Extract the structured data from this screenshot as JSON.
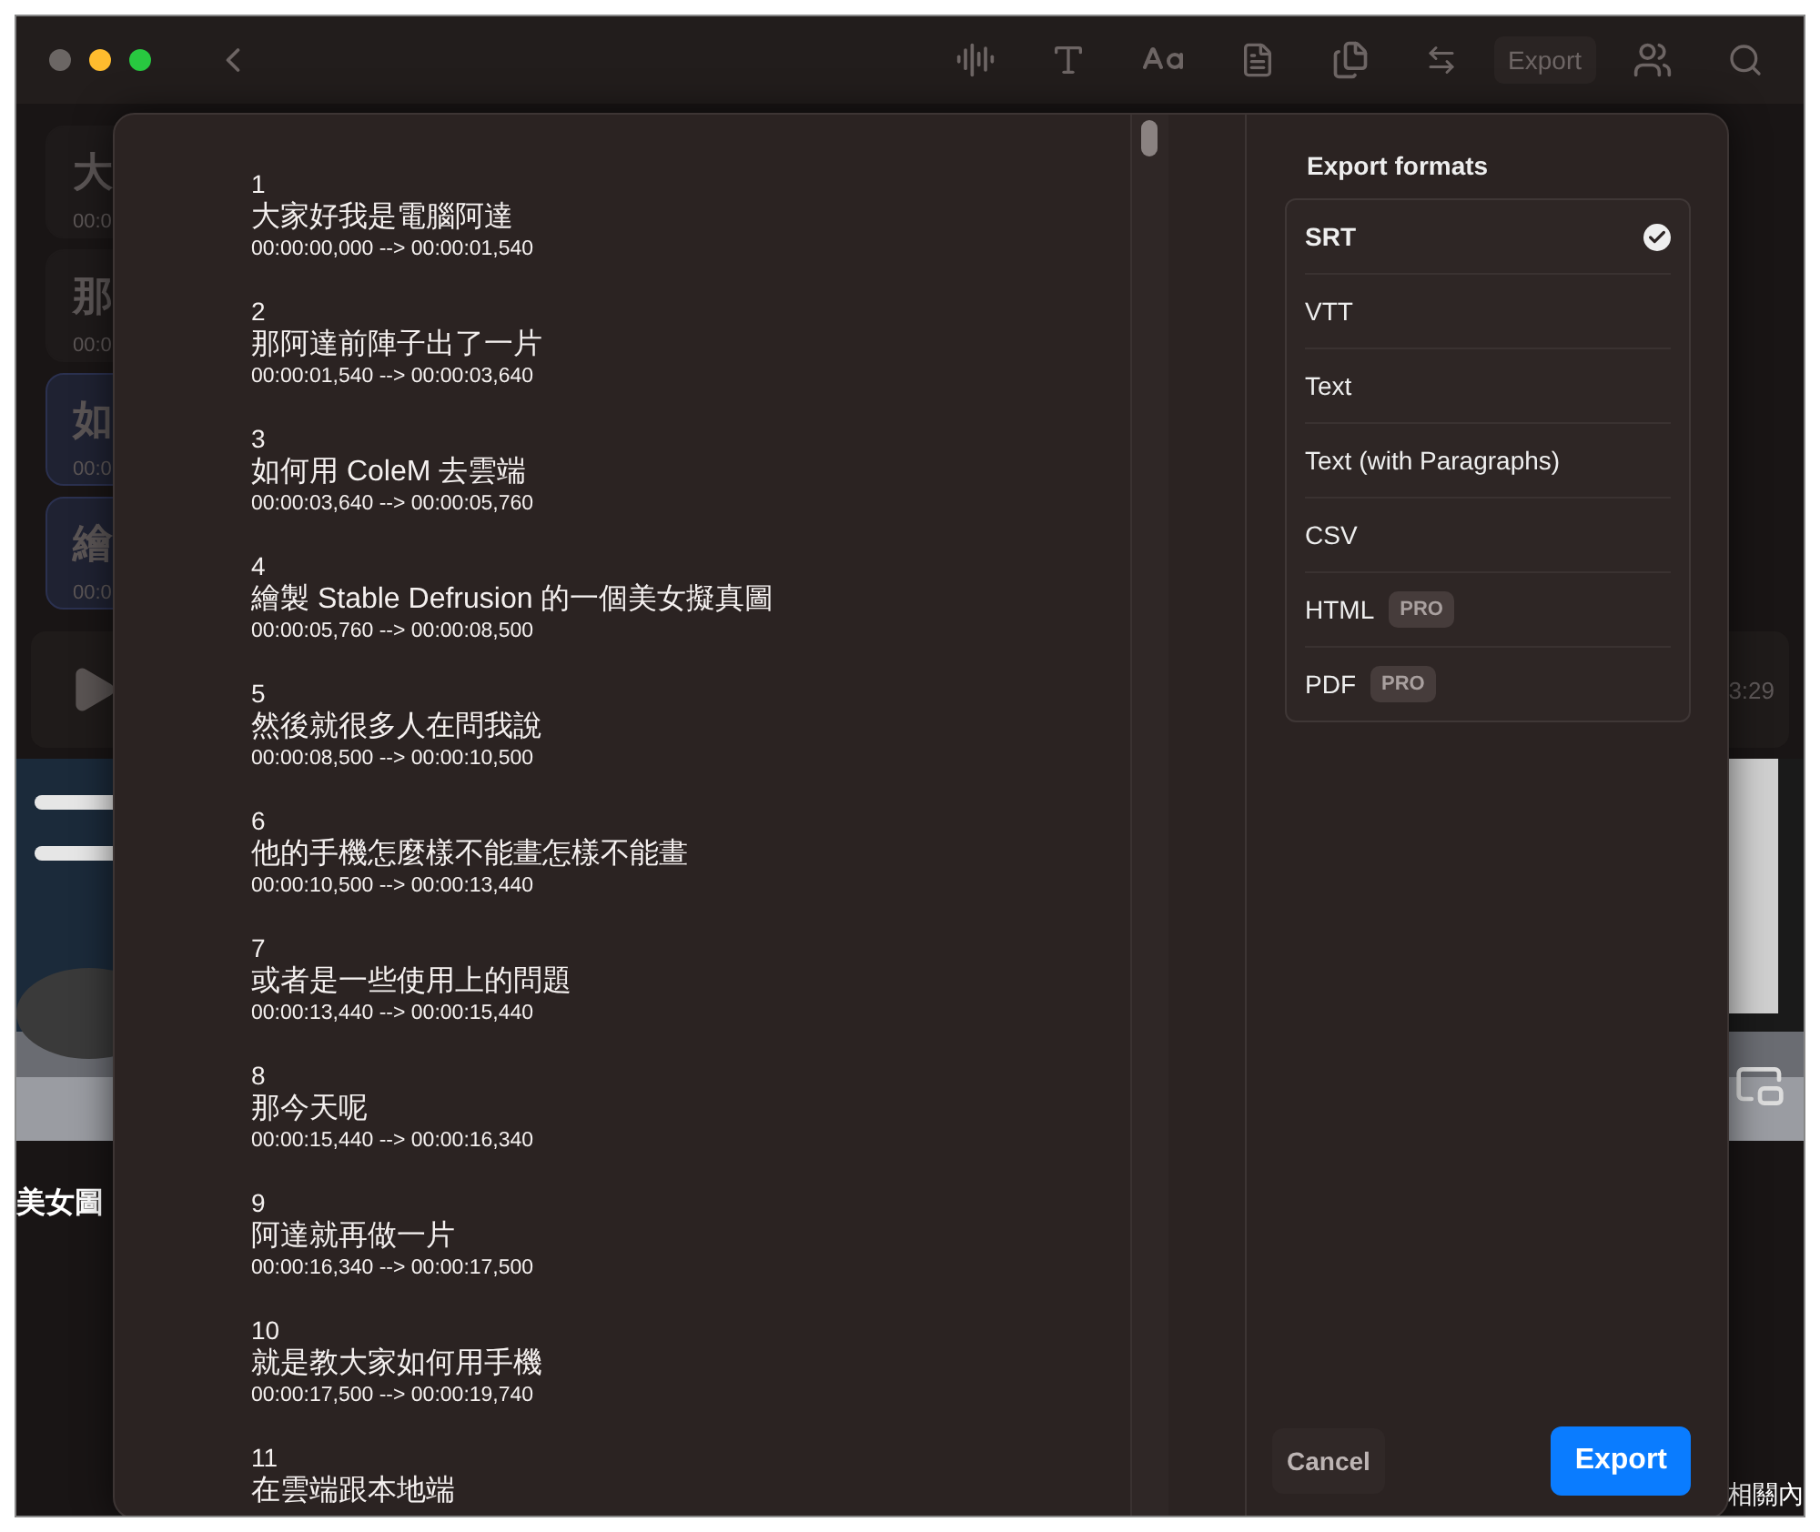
{
  "toolbar": {
    "export_label": "Export"
  },
  "background": {
    "cards": [
      {
        "text": "大",
        "time": "00:0",
        "highlighted": false
      },
      {
        "text": "那",
        "time": "00:0",
        "highlighted": false
      },
      {
        "text": "如",
        "time": "00:0",
        "highlighted": true
      },
      {
        "text": "繪",
        "time": "00:0",
        "highlighted": true
      }
    ],
    "player_time": "3:29",
    "video_title": "美女圖",
    "related": "相關內"
  },
  "subtitles": [
    {
      "index": "1",
      "text": "大家好我是電腦阿達",
      "time": "00:00:00,000 --> 00:00:01,540"
    },
    {
      "index": "2",
      "text": "那阿達前陣子出了一片",
      "time": "00:00:01,540 --> 00:00:03,640"
    },
    {
      "index": "3",
      "text": "如何用 ColeM 去雲端",
      "time": "00:00:03,640 --> 00:00:05,760"
    },
    {
      "index": "4",
      "text": "繪製 Stable Defrusion 的一個美女擬真圖",
      "time": "00:00:05,760 --> 00:00:08,500"
    },
    {
      "index": "5",
      "text": "然後就很多人在問我說",
      "time": "00:00:08,500 --> 00:00:10,500"
    },
    {
      "index": "6",
      "text": "他的手機怎麼樣不能畫怎樣不能畫",
      "time": "00:00:10,500 --> 00:00:13,440"
    },
    {
      "index": "7",
      "text": "或者是一些使用上的問題",
      "time": "00:00:13,440 --> 00:00:15,440"
    },
    {
      "index": "8",
      "text": "那今天呢",
      "time": "00:00:15,440 --> 00:00:16,340"
    },
    {
      "index": "9",
      "text": "阿達就再做一片",
      "time": "00:00:16,340 --> 00:00:17,500"
    },
    {
      "index": "10",
      "text": "就是教大家如何用手機",
      "time": "00:00:17,500 --> 00:00:19,740"
    },
    {
      "index": "11",
      "text": "在雲端跟本地端"
    }
  ],
  "export_panel": {
    "title": "Export formats",
    "formats": [
      {
        "label": "SRT",
        "selected": true
      },
      {
        "label": "VTT",
        "selected": false
      },
      {
        "label": "Text",
        "selected": false
      },
      {
        "label": "Text (with Paragraphs)",
        "selected": false
      },
      {
        "label": "CSV",
        "selected": false
      },
      {
        "label": "HTML",
        "selected": false,
        "badge": "PRO"
      },
      {
        "label": "PDF",
        "selected": false,
        "badge": "PRO"
      }
    ],
    "cancel": "Cancel",
    "confirm": "Export"
  }
}
